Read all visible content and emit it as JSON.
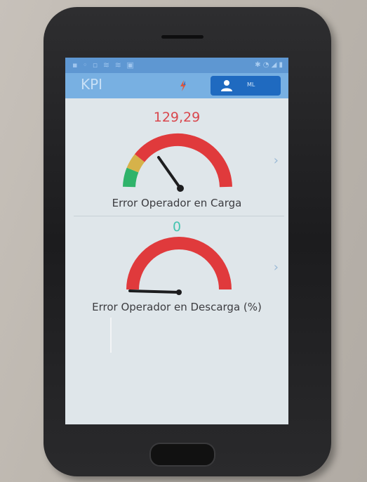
{
  "app": {
    "title": "KPI",
    "user_label": "ML"
  },
  "colors": {
    "appbar": "#78b0e2",
    "statusbar": "#5e97d2",
    "user_button": "#1f6ac0",
    "gauge_red": "#e03a3c",
    "gauge_yellow": "#d6b24a",
    "gauge_green": "#2fb36a",
    "value_red": "#d9474d",
    "value_teal": "#45c4b0"
  },
  "icons": {
    "refresh": "refresh-icon",
    "user": "user-icon",
    "chevron": "chevron-right-icon"
  },
  "gauges": [
    {
      "value": "129,29",
      "caption": "Error Operador en Carga",
      "value_color": "#d9474d"
    },
    {
      "value": "0",
      "caption": "Error Operador en Descarga (%)",
      "value_color": "#45c4b0"
    }
  ]
}
